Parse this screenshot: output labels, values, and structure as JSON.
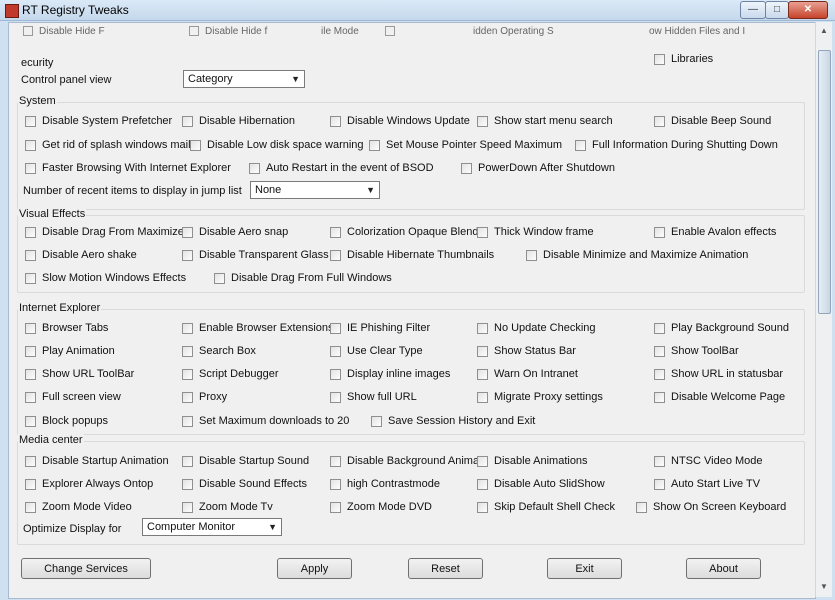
{
  "window": {
    "title": "RT Registry Tweaks",
    "minimize_glyph": "—",
    "maximize_glyph": "□",
    "close_glyph": "✕"
  },
  "top_cut": [
    {
      "label": "Disable Hide F"
    },
    {
      "label": "Disable Hide f"
    },
    {
      "label": "ile Mode"
    },
    {
      "label": "idden Operating S"
    },
    {
      "label": "ow Hidden Files and I"
    }
  ],
  "top": {
    "security_label": "ecurity",
    "libraries_label": "Libraries",
    "control_panel_label": "Control panel view",
    "control_panel_value": "Category"
  },
  "system": {
    "title": "System",
    "items": [
      "Disable System Prefetcher",
      "Disable Hibernation",
      "Disable Windows Update",
      "Show start menu search",
      "Disable Beep Sound",
      "Get rid of splash windows mail",
      "Disable Low disk space warning",
      "Set Mouse Pointer Speed Maximum",
      "Full Information During Shutting Down",
      "Faster Browsing With Internet Explorer",
      "Auto Restart in the event of BSOD",
      "PowerDown After Shutdown"
    ],
    "recent_label": "Number of recent items to display in jump list",
    "recent_value": "None"
  },
  "visual": {
    "title": "Visual Effects",
    "items": [
      "Disable Drag From Maximize",
      "Disable Aero snap",
      "Colorization Opaque Blend",
      "Thick Window frame",
      "Enable Avalon effects",
      "Disable Aero shake",
      "Disable Transparent Glass",
      "Disable Hibernate Thumbnails",
      "Disable Minimize and Maximize Animation",
      "Slow Motion Windows Effects",
      "Disable Drag From Full Windows"
    ]
  },
  "ie": {
    "title": "Internet Explorer",
    "items": [
      "Browser Tabs",
      "Enable Browser Extensions",
      "IE Phishing Filter",
      "No Update Checking",
      "Play Background Sound",
      "Play Animation",
      "Search Box",
      "Use Clear Type",
      "Show Status Bar",
      "Show ToolBar",
      "Show URL ToolBar",
      "Script Debugger",
      "Display inline images",
      "Warn On Intranet",
      "Show URL in statusbar",
      "Full screen view",
      "Proxy",
      "Show full URL",
      "Migrate Proxy settings",
      "Disable Welcome Page",
      "Block popups",
      "Set Maximum downloads to 20",
      "Save Session History and Exit"
    ]
  },
  "media": {
    "title": "Media center",
    "items": [
      "Disable Startup Animation",
      "Disable Startup Sound",
      "Disable Background Anima",
      "Disable Animations",
      "NTSC Video Mode",
      "Explorer Always Ontop",
      "Disable Sound Effects",
      "high Contrastmode",
      "Disable Auto SlidShow",
      "Auto Start Live TV",
      "Zoom Mode Video",
      "Zoom Mode Tv",
      "Zoom Mode DVD",
      "Skip Default Shell Check",
      "Show On Screen Keyboard"
    ],
    "optimize_label": "Optimize Display for",
    "optimize_value": "Computer Monitor"
  },
  "buttons": {
    "change_services": "Change Services",
    "apply": "Apply",
    "reset": "Reset",
    "exit": "Exit",
    "about": "About"
  },
  "icons": {
    "app": "app-icon",
    "dropdown": "chevron-down-icon",
    "scroll_up": "arrow-up-icon",
    "scroll_down": "arrow-down-icon"
  }
}
